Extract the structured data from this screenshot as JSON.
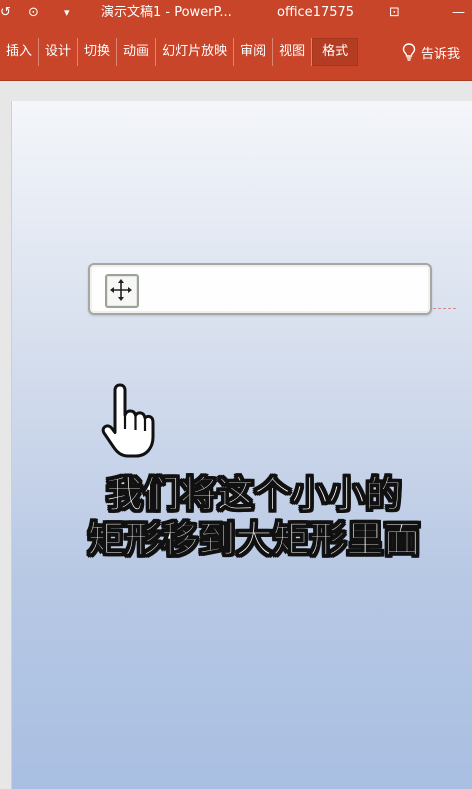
{
  "titlebar": {
    "undo_glyph": "↺",
    "start_glyph": "⊙",
    "qa_glyph": "▾",
    "document_title": "演示文稿1  -  PowerP...",
    "account": "office17575",
    "layout_glyph": "⊡",
    "minimize_glyph": "—"
  },
  "ribbon": {
    "tabs": [
      {
        "label": "插入"
      },
      {
        "label": "设计"
      },
      {
        "label": "切换"
      },
      {
        "label": "动画"
      },
      {
        "label": "幻灯片放映"
      },
      {
        "label": "审阅"
      },
      {
        "label": "视图"
      },
      {
        "label": "格式"
      }
    ],
    "tell_me": "告诉我"
  },
  "caption": {
    "line1": "我们将这个小小的",
    "line2": "矩形移到大矩形里面"
  },
  "colors": {
    "ribbon": "#c8452a",
    "slide_top": "#f4f6fa",
    "slide_bottom": "#a9bfe2"
  }
}
